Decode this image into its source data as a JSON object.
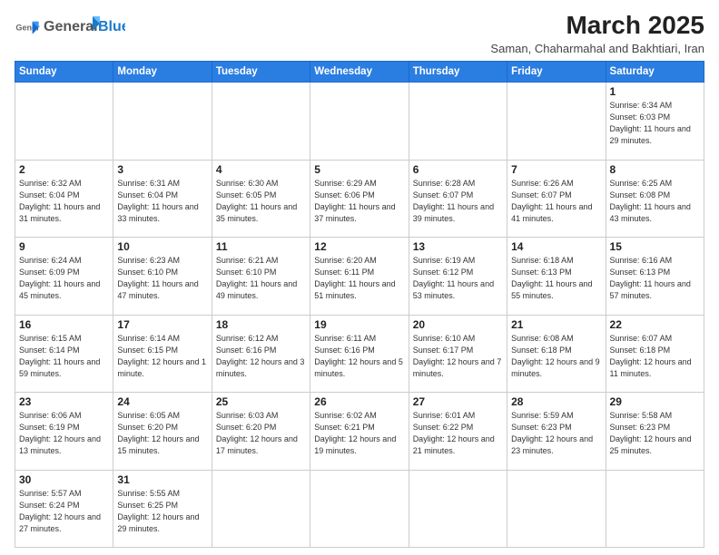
{
  "header": {
    "logo_general": "General",
    "logo_blue": "Blue",
    "month_title": "March 2025",
    "subtitle": "Saman, Chaharmahal and Bakhtiari, Iran"
  },
  "days_of_week": [
    "Sunday",
    "Monday",
    "Tuesday",
    "Wednesday",
    "Thursday",
    "Friday",
    "Saturday"
  ],
  "weeks": [
    [
      {
        "day": "",
        "info": ""
      },
      {
        "day": "",
        "info": ""
      },
      {
        "day": "",
        "info": ""
      },
      {
        "day": "",
        "info": ""
      },
      {
        "day": "",
        "info": ""
      },
      {
        "day": "",
        "info": ""
      },
      {
        "day": "1",
        "info": "Sunrise: 6:34 AM\nSunset: 6:03 PM\nDaylight: 11 hours and 29 minutes."
      }
    ],
    [
      {
        "day": "2",
        "info": "Sunrise: 6:32 AM\nSunset: 6:04 PM\nDaylight: 11 hours and 31 minutes."
      },
      {
        "day": "3",
        "info": "Sunrise: 6:31 AM\nSunset: 6:04 PM\nDaylight: 11 hours and 33 minutes."
      },
      {
        "day": "4",
        "info": "Sunrise: 6:30 AM\nSunset: 6:05 PM\nDaylight: 11 hours and 35 minutes."
      },
      {
        "day": "5",
        "info": "Sunrise: 6:29 AM\nSunset: 6:06 PM\nDaylight: 11 hours and 37 minutes."
      },
      {
        "day": "6",
        "info": "Sunrise: 6:28 AM\nSunset: 6:07 PM\nDaylight: 11 hours and 39 minutes."
      },
      {
        "day": "7",
        "info": "Sunrise: 6:26 AM\nSunset: 6:07 PM\nDaylight: 11 hours and 41 minutes."
      },
      {
        "day": "8",
        "info": "Sunrise: 6:25 AM\nSunset: 6:08 PM\nDaylight: 11 hours and 43 minutes."
      }
    ],
    [
      {
        "day": "9",
        "info": "Sunrise: 6:24 AM\nSunset: 6:09 PM\nDaylight: 11 hours and 45 minutes."
      },
      {
        "day": "10",
        "info": "Sunrise: 6:23 AM\nSunset: 6:10 PM\nDaylight: 11 hours and 47 minutes."
      },
      {
        "day": "11",
        "info": "Sunrise: 6:21 AM\nSunset: 6:10 PM\nDaylight: 11 hours and 49 minutes."
      },
      {
        "day": "12",
        "info": "Sunrise: 6:20 AM\nSunset: 6:11 PM\nDaylight: 11 hours and 51 minutes."
      },
      {
        "day": "13",
        "info": "Sunrise: 6:19 AM\nSunset: 6:12 PM\nDaylight: 11 hours and 53 minutes."
      },
      {
        "day": "14",
        "info": "Sunrise: 6:18 AM\nSunset: 6:13 PM\nDaylight: 11 hours and 55 minutes."
      },
      {
        "day": "15",
        "info": "Sunrise: 6:16 AM\nSunset: 6:13 PM\nDaylight: 11 hours and 57 minutes."
      }
    ],
    [
      {
        "day": "16",
        "info": "Sunrise: 6:15 AM\nSunset: 6:14 PM\nDaylight: 11 hours and 59 minutes."
      },
      {
        "day": "17",
        "info": "Sunrise: 6:14 AM\nSunset: 6:15 PM\nDaylight: 12 hours and 1 minute."
      },
      {
        "day": "18",
        "info": "Sunrise: 6:12 AM\nSunset: 6:16 PM\nDaylight: 12 hours and 3 minutes."
      },
      {
        "day": "19",
        "info": "Sunrise: 6:11 AM\nSunset: 6:16 PM\nDaylight: 12 hours and 5 minutes."
      },
      {
        "day": "20",
        "info": "Sunrise: 6:10 AM\nSunset: 6:17 PM\nDaylight: 12 hours and 7 minutes."
      },
      {
        "day": "21",
        "info": "Sunrise: 6:08 AM\nSunset: 6:18 PM\nDaylight: 12 hours and 9 minutes."
      },
      {
        "day": "22",
        "info": "Sunrise: 6:07 AM\nSunset: 6:18 PM\nDaylight: 12 hours and 11 minutes."
      }
    ],
    [
      {
        "day": "23",
        "info": "Sunrise: 6:06 AM\nSunset: 6:19 PM\nDaylight: 12 hours and 13 minutes."
      },
      {
        "day": "24",
        "info": "Sunrise: 6:05 AM\nSunset: 6:20 PM\nDaylight: 12 hours and 15 minutes."
      },
      {
        "day": "25",
        "info": "Sunrise: 6:03 AM\nSunset: 6:20 PM\nDaylight: 12 hours and 17 minutes."
      },
      {
        "day": "26",
        "info": "Sunrise: 6:02 AM\nSunset: 6:21 PM\nDaylight: 12 hours and 19 minutes."
      },
      {
        "day": "27",
        "info": "Sunrise: 6:01 AM\nSunset: 6:22 PM\nDaylight: 12 hours and 21 minutes."
      },
      {
        "day": "28",
        "info": "Sunrise: 5:59 AM\nSunset: 6:23 PM\nDaylight: 12 hours and 23 minutes."
      },
      {
        "day": "29",
        "info": "Sunrise: 5:58 AM\nSunset: 6:23 PM\nDaylight: 12 hours and 25 minutes."
      }
    ],
    [
      {
        "day": "30",
        "info": "Sunrise: 5:57 AM\nSunset: 6:24 PM\nDaylight: 12 hours and 27 minutes."
      },
      {
        "day": "31",
        "info": "Sunrise: 5:55 AM\nSunset: 6:25 PM\nDaylight: 12 hours and 29 minutes."
      },
      {
        "day": "",
        "info": ""
      },
      {
        "day": "",
        "info": ""
      },
      {
        "day": "",
        "info": ""
      },
      {
        "day": "",
        "info": ""
      },
      {
        "day": "",
        "info": ""
      }
    ]
  ]
}
